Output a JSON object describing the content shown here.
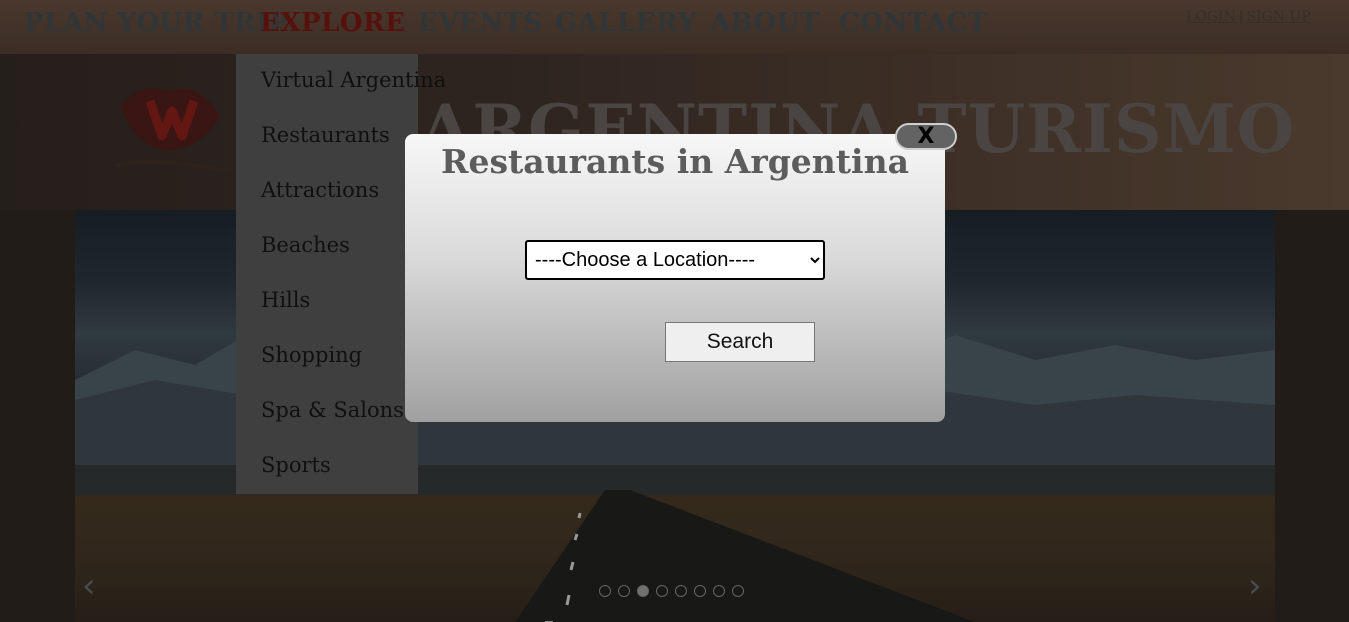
{
  "nav": {
    "items": [
      {
        "label": "PLAN YOUR TRIP",
        "active": false
      },
      {
        "label": "EXPLORE",
        "active": true
      },
      {
        "label": "EVENTS",
        "active": false
      },
      {
        "label": "GALLERY",
        "active": false
      },
      {
        "label": "ABOUT",
        "active": false
      },
      {
        "label": "CONTACT",
        "active": false
      }
    ],
    "login_label": "LOGIN",
    "separator": "|",
    "signup_label": "SIGN UP",
    "active_color": "#6a1410"
  },
  "header": {
    "site_title": "ARGENTINA TURISMO"
  },
  "explore_menu": {
    "items": [
      "Virtual Argentina",
      "Restaurants",
      "Attractions",
      "Beaches",
      "Hills",
      "Shopping",
      "Spa & Salons",
      "Sports"
    ]
  },
  "slider": {
    "prev_icon": "chevron-left-icon",
    "next_icon": "chevron-right-icon",
    "prev_glyph": "‹",
    "next_glyph": "›",
    "slide_count": 8,
    "active_slide": 3
  },
  "modal": {
    "title": "Restaurants in Argentina",
    "close_label": "X",
    "location_select": {
      "selected": "----Choose a Location----"
    },
    "search_label": "Search"
  }
}
